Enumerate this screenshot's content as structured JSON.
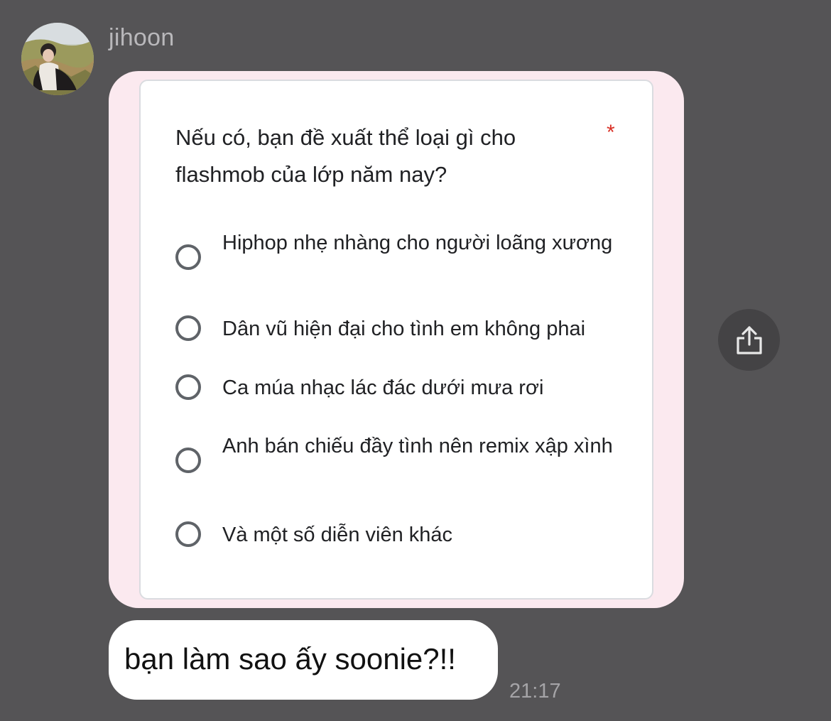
{
  "chat": {
    "sender_name": "jihoon",
    "timestamp": "21:17",
    "text_message": "bạn làm sao ấy soonie?!!"
  },
  "form": {
    "question": "Nếu có, bạn đề xuất thể loại gì cho flashmob của lớp năm nay?",
    "required_mark": "*",
    "options": [
      {
        "label": "Hiphop nhẹ nhàng cho người loãng xương"
      },
      {
        "label": "Dân vũ hiện đại cho tình em không phai"
      },
      {
        "label": "Ca múa nhạc lác đác dưới mưa rơi"
      },
      {
        "label": "Anh bán chiếu đầy tình nên remix xập xình"
      },
      {
        "label": "Và một số diễn viên khác"
      }
    ]
  },
  "icons": {
    "share": "share-icon",
    "avatar": "avatar-photo"
  },
  "colors": {
    "background": "#555456",
    "bubble_pink": "#fbe9ef",
    "required_red": "#d93025"
  }
}
